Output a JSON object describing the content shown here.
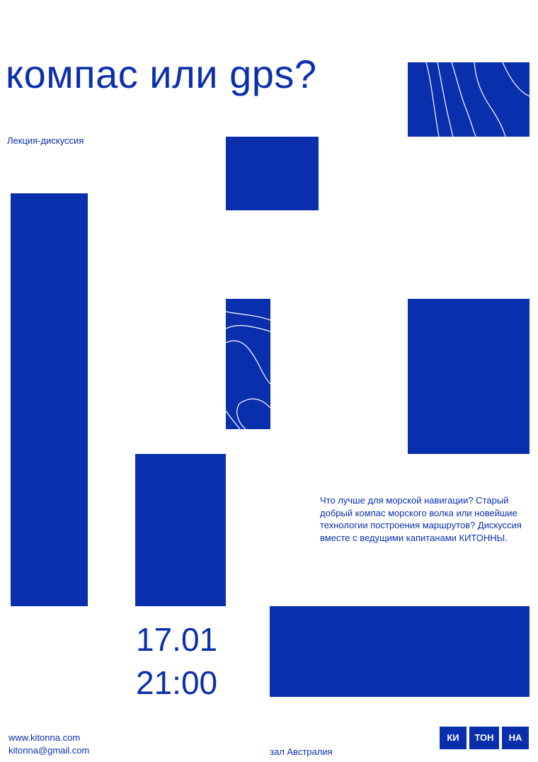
{
  "poster": {
    "title": "компас или gps?",
    "subtitle": "Лекция-дискуссия",
    "description": "Что лучше для морской навигации? Старый добрый компас морского волка или новейшие технологии построения маршрутов? Дискуссия вместе с ведущими капитанами КИТОННЫ.",
    "date": "17.01",
    "time": "21:00",
    "website": "www.kitonna.com",
    "email": "kitonna@gmail.com",
    "venue": "зал Австралия",
    "logo_parts": [
      "КИ",
      "ТОН",
      "НА"
    ],
    "accent_color": "#0a2fad",
    "background_color": "#ffffff"
  }
}
